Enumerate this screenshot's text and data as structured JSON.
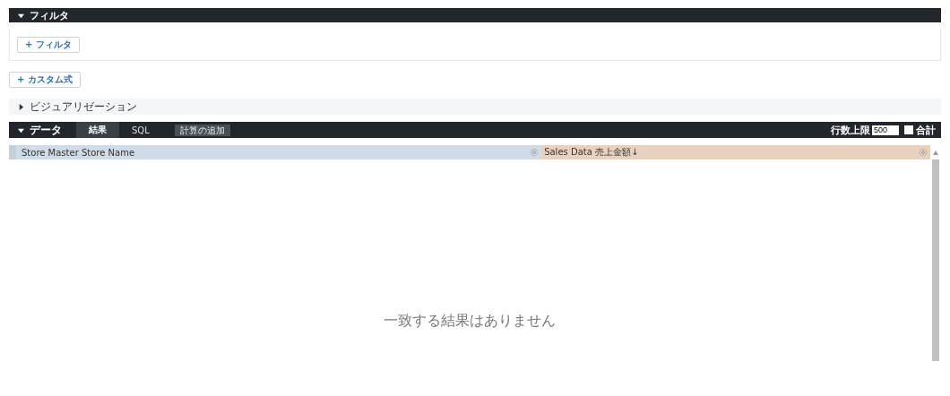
{
  "filter_section": {
    "title": "フィルタ",
    "expanded": true,
    "add_filter_button": "+ フィルタ"
  },
  "custom_expression_button": "+ カスタム式",
  "visualization_section": {
    "title": "ビジュアリゼーション",
    "expanded": false
  },
  "data_section": {
    "title": "データ",
    "expanded": true,
    "tabs": [
      {
        "label": "結果",
        "selected": true
      },
      {
        "label": "SQL",
        "selected": false
      }
    ],
    "add_calculation_button": "計算の追加",
    "row_limit": {
      "label": "行数上限",
      "value": "500"
    },
    "total": {
      "label": "合計",
      "checked": false
    }
  },
  "table": {
    "columns": [
      {
        "label": "Store Master Store Name",
        "kind": "dimension"
      },
      {
        "label": "Sales Data 売上金額",
        "kind": "measure",
        "sort": "↓"
      }
    ],
    "empty_message": "一致する結果はありません"
  }
}
